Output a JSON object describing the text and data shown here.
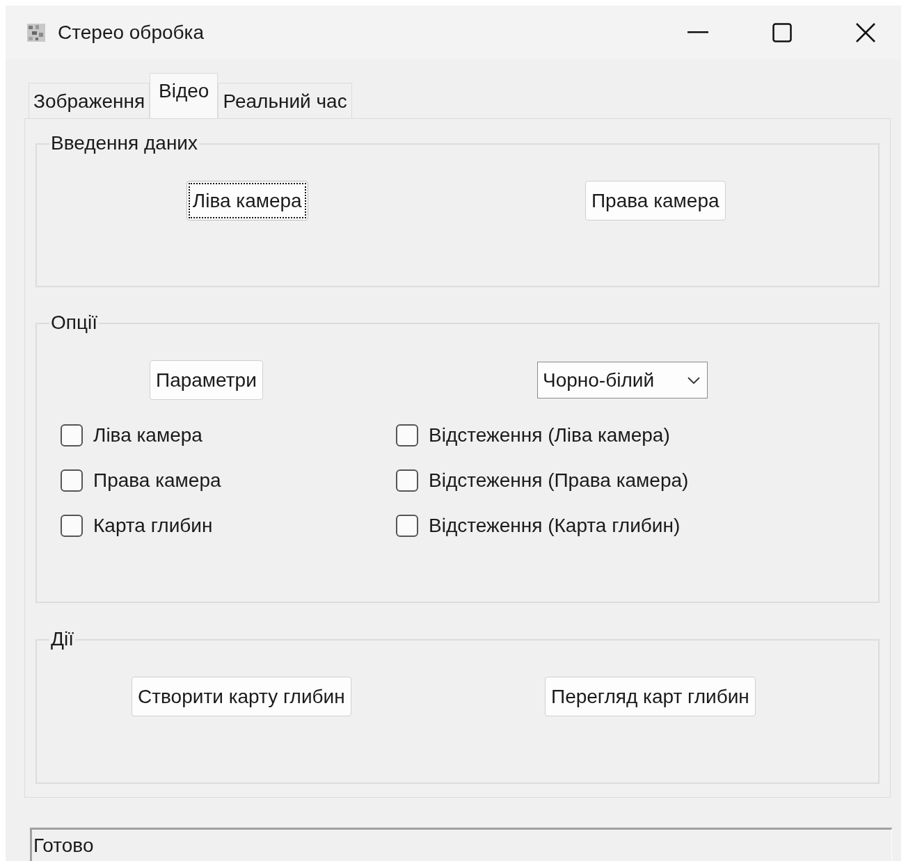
{
  "window": {
    "title": "Стерео обробка"
  },
  "tabs": [
    {
      "label": "Зображення",
      "selected": false
    },
    {
      "label": "Відео",
      "selected": true
    },
    {
      "label": "Реальний час",
      "selected": false
    }
  ],
  "input_group": {
    "title": "Введення даних",
    "buttons": [
      {
        "label": "Ліва камера",
        "focused": true
      },
      {
        "label": "Права камера",
        "focused": false
      }
    ]
  },
  "options_group": {
    "title": "Опції",
    "button": {
      "label": "Параметри",
      "focused": false
    },
    "dropdown": {
      "value": "Чорно-білий"
    },
    "checkboxes_left": [
      {
        "label": "Ліва камера",
        "checked": false
      },
      {
        "label": "Права камера",
        "checked": false
      },
      {
        "label": "Карта глибин",
        "checked": false
      }
    ],
    "checkboxes_right": [
      {
        "label": "Відстеження (Ліва камера)",
        "checked": false
      },
      {
        "label": "Відстеження (Права камера)",
        "checked": false
      },
      {
        "label": "Відстеження (Карта глибин)",
        "checked": false
      }
    ]
  },
  "actions_group": {
    "title": "Дії",
    "buttons": [
      {
        "label": "Створити карту глибин",
        "focused": false
      },
      {
        "label": "Перегляд карт глибин",
        "focused": false
      }
    ]
  },
  "status_bar": {
    "text": "Готово"
  }
}
